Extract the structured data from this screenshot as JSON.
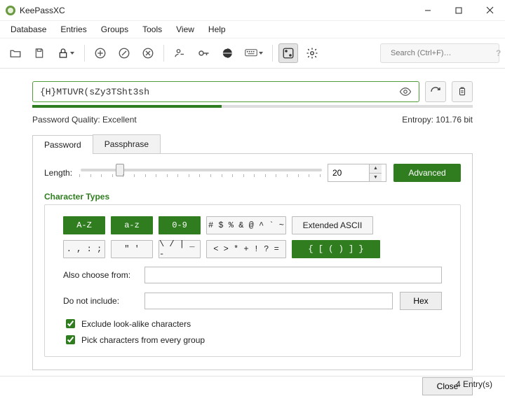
{
  "window": {
    "title": "KeePassXC"
  },
  "menu": [
    "Database",
    "Entries",
    "Groups",
    "Tools",
    "View",
    "Help"
  ],
  "search": {
    "placeholder": "Search (Ctrl+F)…"
  },
  "password": {
    "value": "{H}MTUVR(sZy3TSht3sh"
  },
  "quality": {
    "label": "Password Quality: Excellent",
    "entropy": "Entropy: 101.76 bit",
    "fill_percent": 43
  },
  "tabs": {
    "password": "Password",
    "passphrase": "Passphrase"
  },
  "length": {
    "label": "Length:",
    "value": "20",
    "advanced": "Advanced"
  },
  "chartypes": {
    "title": "Character Types",
    "row1": [
      {
        "label": "A-Z",
        "on": true,
        "cls": "w1"
      },
      {
        "label": "a-z",
        "on": true,
        "cls": "w1"
      },
      {
        "label": "0-9",
        "on": true,
        "cls": "w1"
      },
      {
        "label": "# $ % && @ ^ ` ~",
        "on": false,
        "cls": "w2"
      },
      {
        "label": "Extended ASCII",
        "on": false,
        "cls": "w3",
        "sans": true
      }
    ],
    "row2": [
      {
        "label": ". , : ;",
        "on": false,
        "cls": "w1"
      },
      {
        "label": "\" '",
        "on": false,
        "cls": "w1"
      },
      {
        "label": "\\ / | _ -",
        "on": false,
        "cls": "w1"
      },
      {
        "label": "< > * + ! ? =",
        "on": false,
        "cls": "w2"
      },
      {
        "label": "{ [ ( ) ] }",
        "on": true,
        "cls": "w4"
      }
    ],
    "also": "Also choose from:",
    "exclude_label": "Do not include:",
    "hex": "Hex",
    "chk1": "Exclude look-alike characters",
    "chk2": "Pick characters from every group"
  },
  "close": "Close",
  "status": "4 Entry(s)"
}
